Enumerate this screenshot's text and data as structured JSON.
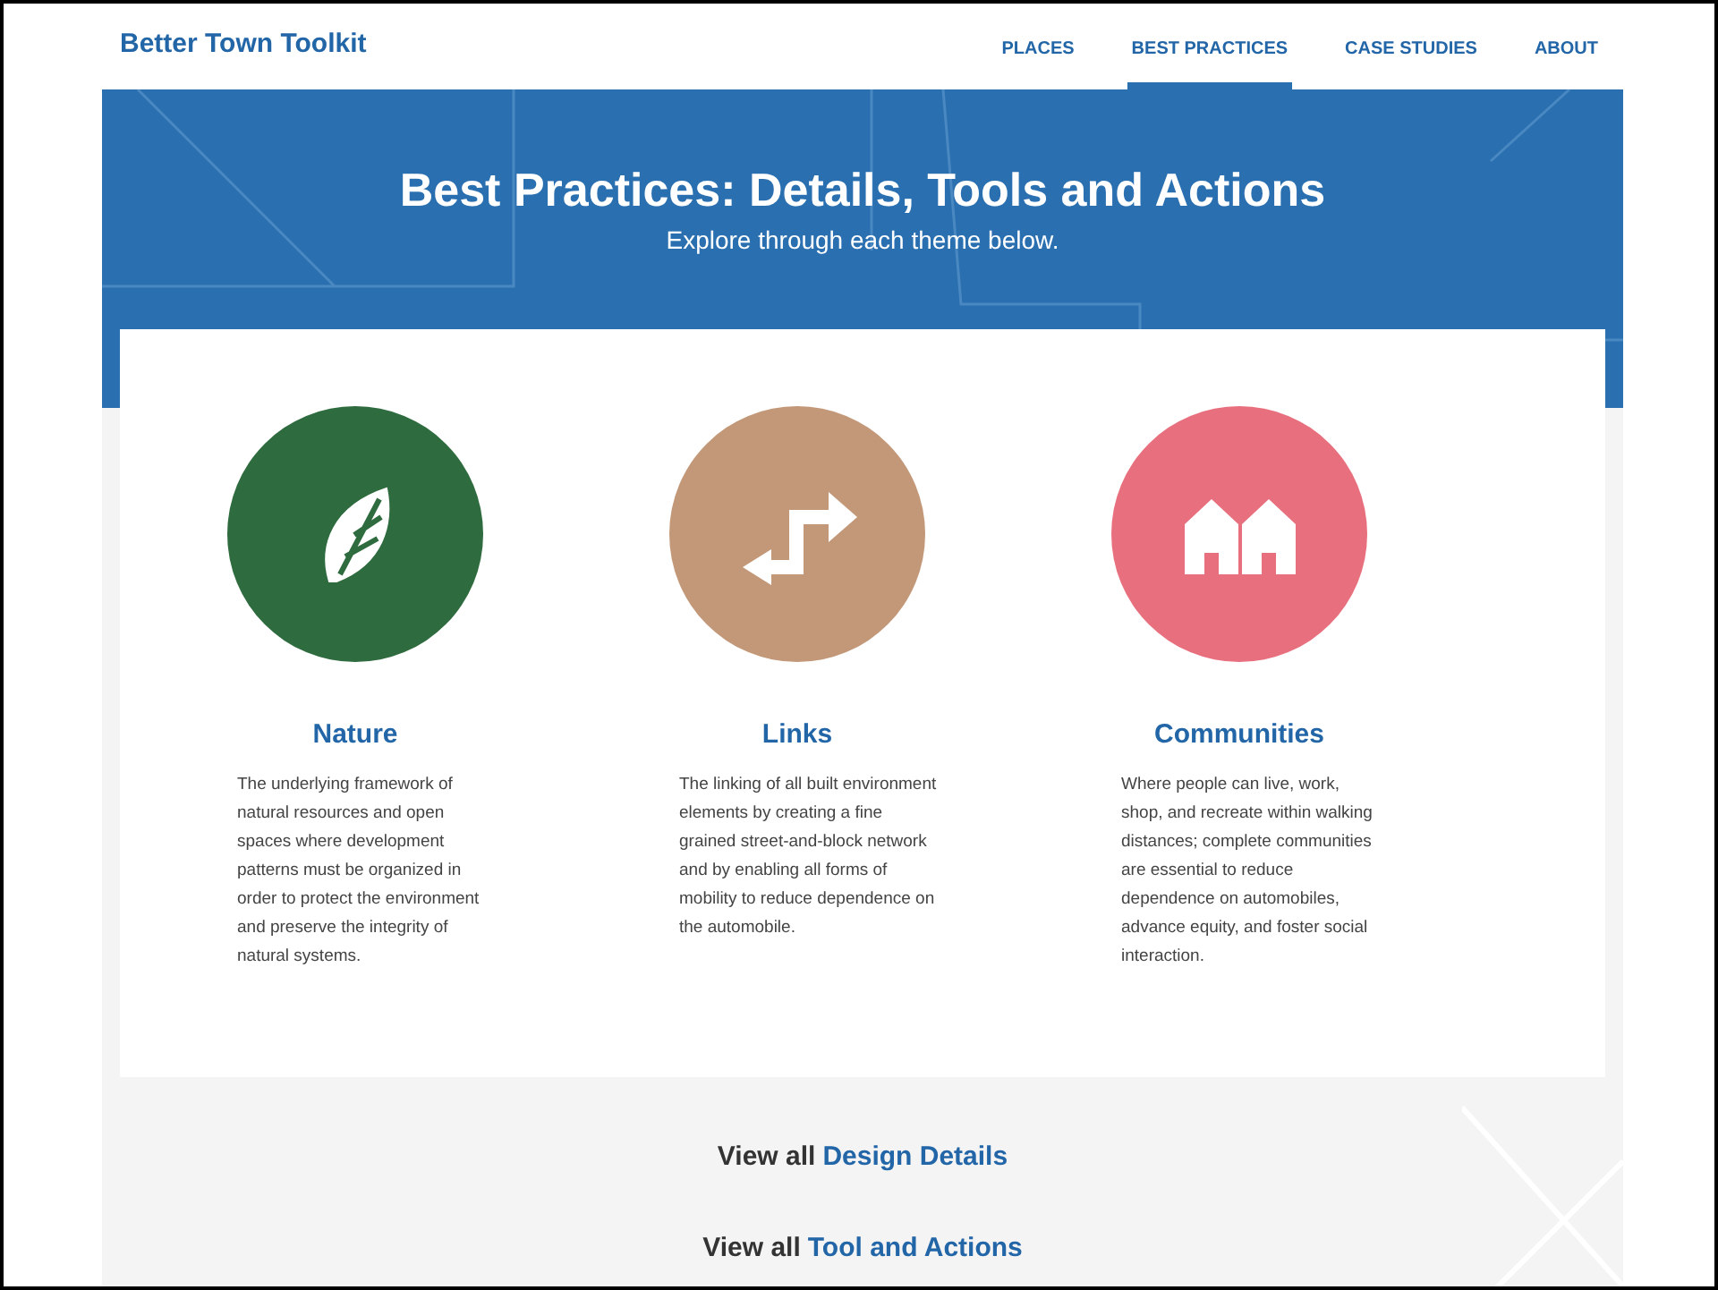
{
  "site": {
    "logo": "Better Town Toolkit"
  },
  "nav": [
    {
      "label": "PLACES",
      "selected": false
    },
    {
      "label": "BEST PRACTICES",
      "selected": true
    },
    {
      "label": "CASE STUDIES",
      "selected": false
    },
    {
      "label": "ABOUT",
      "selected": false
    }
  ],
  "hero": {
    "title": "Best Practices: Details, Tools and Actions",
    "subtitle": "Explore through each theme below."
  },
  "themes": [
    {
      "kind": "leaf",
      "color": "#2e6b3e",
      "title": "Nature",
      "description": "The underlying framework of natural resources and open spaces where development patterns must be organized in order to protect the environment and preserve the integrity of natural systems."
    },
    {
      "kind": "arrows",
      "color": "#c29878",
      "title": "Links",
      "description": "The linking of all built environment elements by creating a fine grained street-and-block network and by enabling all forms of mobility to reduce dependence on the automobile."
    },
    {
      "kind": "houses",
      "color": "#e8707e",
      "title": "Communities",
      "description": "Where people can live, work, shop, and recreate within walking distances; complete communities are essential to reduce dependence on automobiles, advance equity, and foster social interaction."
    }
  ],
  "view_all": [
    {
      "prefix": "View all",
      "link": "Design Details"
    },
    {
      "prefix": "View all",
      "link": "Tool and Actions"
    }
  ]
}
